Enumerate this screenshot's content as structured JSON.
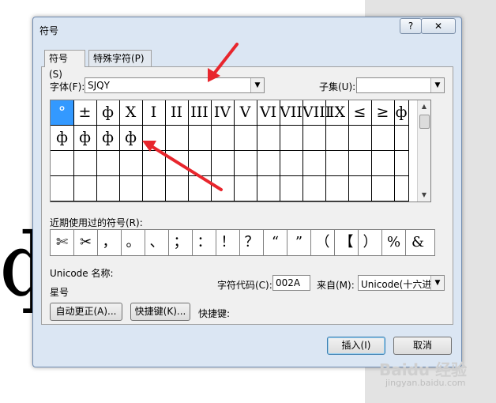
{
  "background": {
    "big_glyph": "ф"
  },
  "dialog": {
    "title": "符号",
    "help_label": "?",
    "close_label": "✕",
    "tabs": [
      {
        "label": "符号(S)"
      },
      {
        "label": "特殊字符(P)"
      }
    ],
    "font_label": "字体(F):",
    "font_value": "SJQY",
    "subset_label": "子集(U):",
    "subset_value": "",
    "symbols": [
      [
        "°",
        "±",
        "ф",
        "X",
        "I",
        "II",
        "III",
        "IV",
        "V",
        "VI",
        "VII",
        "VIII",
        "IX",
        "≤",
        "≥",
        "ф"
      ],
      [
        "ф",
        "ф",
        "ф",
        "ф",
        "",
        "",
        "",
        "",
        "",
        "",
        "",
        "",
        "",
        "",
        "",
        ""
      ],
      [
        "",
        "",
        "",
        "",
        "",
        "",
        "",
        "",
        "",
        "",
        "",
        "",
        "",
        "",
        "",
        ""
      ],
      [
        "",
        "",
        "",
        "",
        "",
        "",
        "",
        "",
        "",
        "",
        "",
        "",
        "",
        "",
        "",
        ""
      ]
    ],
    "recent_label": "近期使用过的符号(R):",
    "recent": [
      "✄",
      "✂",
      "，",
      "。",
      "、",
      "；",
      "：",
      "！",
      "？",
      "“",
      "”",
      "（",
      "【",
      "）",
      "%",
      "&"
    ],
    "unicode_name_label": "Unicode 名称:",
    "unicode_name_value": "星号",
    "char_code_label": "字符代码(C):",
    "char_code_value": "002A",
    "from_label": "来自(M):",
    "from_value": "Unicode(十六进",
    "autocorrect_label": "自动更正(A)...",
    "shortcut_key_btn_label": "快捷键(K)...",
    "shortcut_label": "快捷键:",
    "insert_label": "插入(I)",
    "cancel_label": "取消"
  },
  "watermark": {
    "brand": "Baidu 经验",
    "url": "jingyan.baidu.com"
  },
  "colors": {
    "arrow": "#e8262d",
    "selection": "#3399ff"
  }
}
